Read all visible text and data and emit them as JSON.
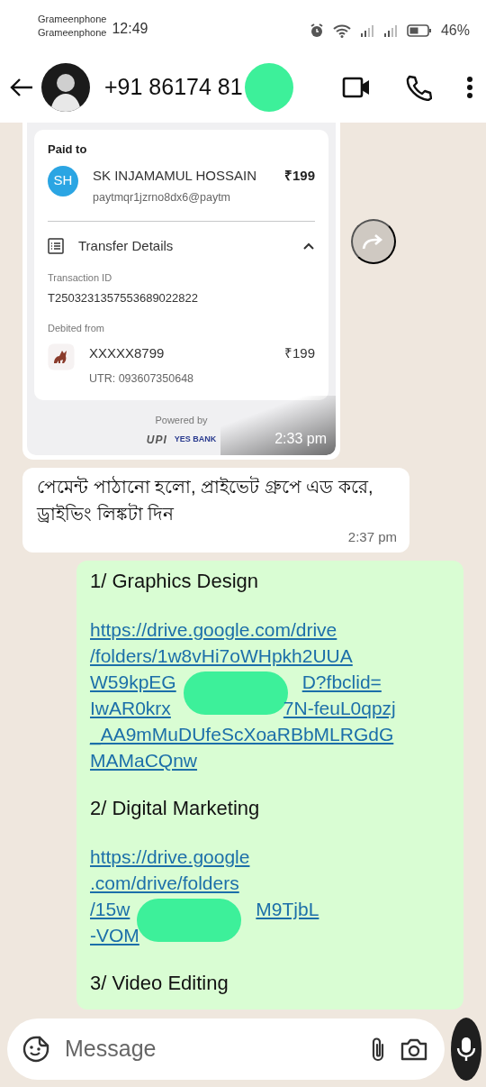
{
  "status_bar": {
    "carriers": [
      "Grameenphone",
      "Grameenphone"
    ],
    "time": "12:49",
    "battery": "46%"
  },
  "header": {
    "title": "+91 86174 81",
    "redacted": true
  },
  "messages": [
    {
      "kind": "payment",
      "outgoing": false,
      "time": "2:33 pm",
      "card": {
        "paid_to_label": "Paid to",
        "initials": "SH",
        "payee": "SK INJAMAMUL HOSSAIN",
        "amount": "₹199",
        "upi_id": "paytmqr1jzrno8dx6@paytm",
        "section": "Transfer Details",
        "expanded": true,
        "txn_label": "Transaction ID",
        "txn_id": "T2503231357553689022822",
        "debited_label": "Debited from",
        "account": "XXXXX8799",
        "account_amount": "₹199",
        "utr": "UTR: 093607350648",
        "powered_by": "Powered by",
        "upi": "UPI",
        "bank": "YES BANK"
      }
    },
    {
      "kind": "text",
      "outgoing": false,
      "text": "পেমেন্ট পাঠানো হলো, প্রাইভেট গ্রুপে এড করে, ড্রাইভিং লিঙ্কটা দিন",
      "time": "2:37 pm"
    },
    {
      "kind": "list",
      "outgoing": true,
      "blocks": [
        {
          "kind": "heading",
          "text": "1/ Graphics Design"
        },
        {
          "kind": "link",
          "lines": [
            [
              {
                "text": "https://drive.google.com/drive"
              }
            ],
            [
              {
                "text": "/folders/1w8vHi7oWHpkh2UUA"
              }
            ],
            [
              {
                "text": "W59kpEG"
              },
              {
                "kind": "redacted"
              },
              {
                "text": "D?fbclid="
              }
            ],
            [
              {
                "text": "IwAR0krx"
              },
              {
                "kind": "covered"
              },
              {
                "text": "7N-feuL0qpzj"
              }
            ],
            [
              {
                "text": "_AA9mMuDUfeScXoaRBbMLRGdG"
              }
            ],
            [
              {
                "text": "MAMaCQnw"
              }
            ]
          ]
        },
        {
          "kind": "heading",
          "text": "2/ Digital Marketing"
        },
        {
          "kind": "link",
          "lines": [
            [
              {
                "text": "https://drive.google"
              }
            ],
            [
              {
                "text": ".com/drive/folders"
              }
            ],
            [
              {
                "text": "/15w"
              },
              {
                "kind": "redacted"
              },
              {
                "text": "M9TjbL"
              }
            ],
            [
              {
                "text": "-VOM"
              },
              {
                "kind": "covered"
              }
            ]
          ]
        },
        {
          "kind": "heading",
          "text": "3/ Video Editing"
        }
      ]
    }
  ],
  "composer": {
    "placeholder": "Message"
  }
}
